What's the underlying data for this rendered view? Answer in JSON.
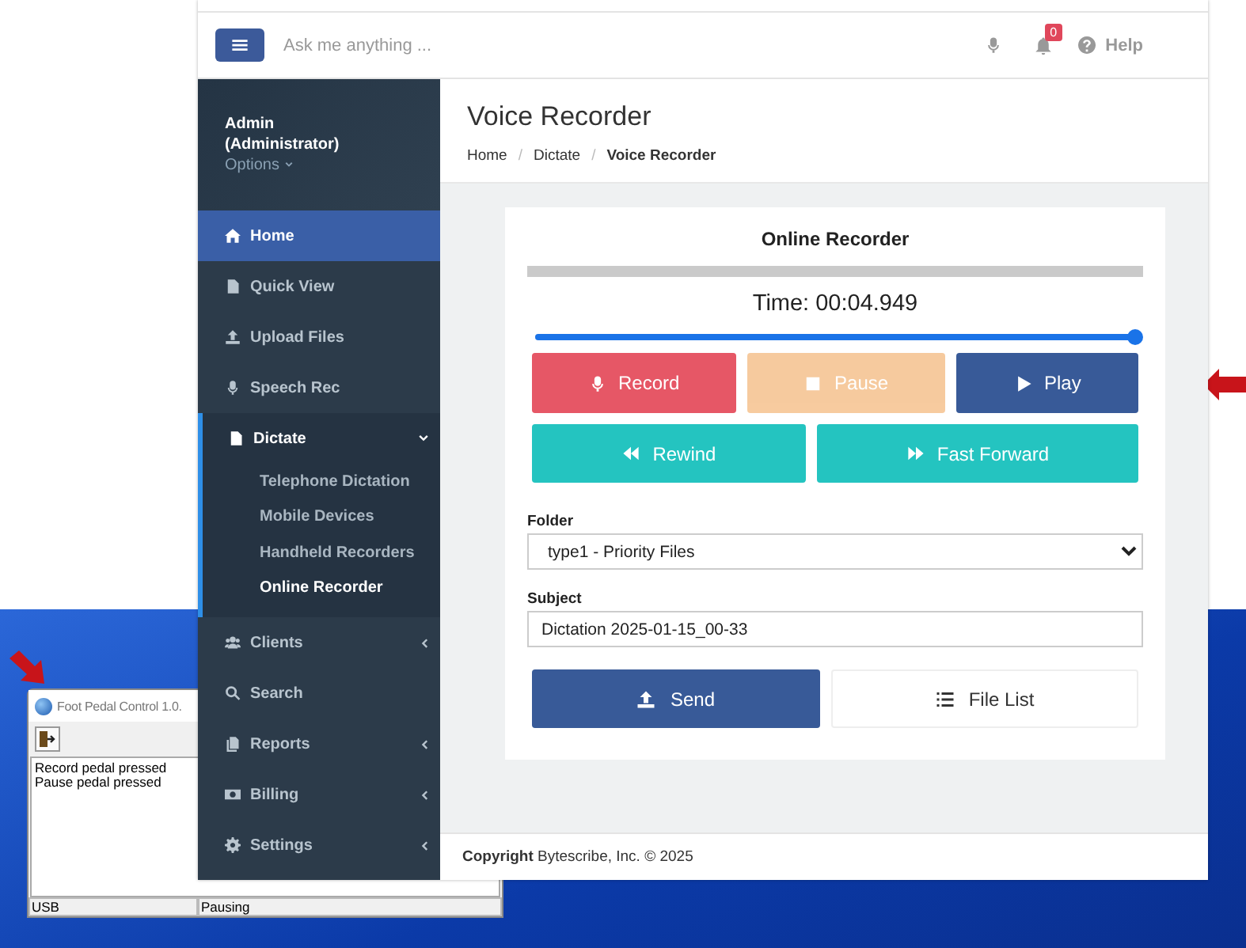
{
  "browser": {
    "header": {
      "search": {
        "placeholder": "Ask me anything ..."
      },
      "notifications": {
        "count": "0"
      },
      "help": "Help"
    },
    "sidebar": {
      "user": {
        "name": "Admin",
        "role": "(Administrator)",
        "options": "Options"
      },
      "items": [
        {
          "label": "Home",
          "kind": "link",
          "selected": true
        },
        {
          "label": "Quick View",
          "kind": "link",
          "selected": false
        },
        {
          "label": "Upload Files",
          "kind": "link",
          "selected": false
        },
        {
          "label": "Speech Rec",
          "kind": "link",
          "selected": false
        },
        {
          "label": "Dictate",
          "kind": "group",
          "selected": false,
          "expanded": true,
          "children": [
            {
              "label": "Telephone Dictation",
              "selected": false
            },
            {
              "label": "Mobile Devices",
              "selected": false
            },
            {
              "label": "Handheld Recorders",
              "selected": false
            },
            {
              "label": "Online Recorder",
              "selected": true
            }
          ]
        },
        {
          "label": "Clients",
          "kind": "group",
          "selected": false,
          "expanded": false
        },
        {
          "label": "Search",
          "kind": "link",
          "selected": false
        },
        {
          "label": "Reports",
          "kind": "group",
          "selected": false,
          "expanded": false
        },
        {
          "label": "Billing",
          "kind": "group",
          "selected": false,
          "expanded": false
        },
        {
          "label": "Settings",
          "kind": "group",
          "selected": false,
          "expanded": false
        }
      ]
    },
    "page": {
      "title": "Voice Recorder",
      "breadcrumb": [
        {
          "label": "Home",
          "current": false,
          "separator": "/"
        },
        {
          "label": "Dictate",
          "current": false,
          "separator": "/"
        },
        {
          "label": "Voice Recorder",
          "current": true
        }
      ]
    },
    "recorder": {
      "title": "Online Recorder",
      "time": "Time: 00:04.949",
      "position": {
        "level": 1
      },
      "controls": [
        {
          "label": "Record",
          "kind": "record",
          "disabled": false
        },
        {
          "label": "Pause",
          "kind": "pause",
          "disabled": true
        },
        {
          "label": "Play",
          "kind": "play",
          "disabled": false
        },
        {
          "label": "Rewind",
          "kind": "rewind",
          "disabled": false
        },
        {
          "label": "Fast Forward",
          "kind": "forward",
          "disabled": false
        }
      ],
      "folder": {
        "label": "Folder",
        "value": "type1 - Priority Files"
      },
      "subject": {
        "label": "Subject",
        "value": "Dictation 2025-01-15_00-33"
      },
      "actions": [
        {
          "label": "Send",
          "kind": "send"
        },
        {
          "label": "File List",
          "kind": "list"
        }
      ]
    },
    "footer": "**Copyright** Bytescribe, Inc. © 2025"
  },
  "pedal_window": {
    "title": "Foot Pedal Control 1.0.",
    "log": [
      "Record pedal pressed",
      "Pause pedal pressed"
    ],
    "status_bar": [
      "USB",
      "Pausing"
    ]
  }
}
